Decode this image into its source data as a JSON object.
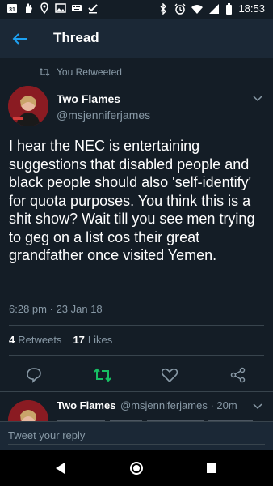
{
  "status_bar": {
    "time": "18:53",
    "left_icons": [
      "calendar-icon",
      "hand-icon",
      "location-icon",
      "image-icon",
      "keyboard-icon",
      "check-icon"
    ],
    "calendar_day": "31",
    "right_icons": [
      "bluetooth-icon",
      "alarm-icon",
      "wifi-icon",
      "signal-icon",
      "battery-icon"
    ]
  },
  "header": {
    "title": "Thread",
    "back_icon": "back-arrow-icon"
  },
  "tweet": {
    "retweet_label": "You Retweeted",
    "author_name": "Two Flames",
    "author_handle": "@msjenniferjames",
    "text": "I hear the NEC is entertaining suggestions that disabled people and black people should also 'self-identify' for quota purposes. You think this is a shit show? Wait till you see men trying to geg on a list cos their great grandfather once visited Yemen.",
    "time": "6:28 pm",
    "date": "23 Jan 18",
    "retweet_count": "4",
    "retweet_label_stat": "Retweets",
    "like_count": "17",
    "like_label_stat": "Likes"
  },
  "actions": {
    "reply_icon": "reply-icon",
    "retweet_icon": "retweet-icon",
    "like_icon": "heart-icon",
    "share_icon": "share-icon",
    "retweet_active_color": "#17bf63"
  },
  "reply": {
    "author_name": "Two Flames",
    "handle_time": "@msjenniferjames · 20m"
  },
  "compose": {
    "placeholder": "Tweet your reply"
  },
  "nav": {
    "back_icon": "nav-back-icon",
    "home_icon": "nav-home-icon",
    "recents_icon": "nav-recents-icon"
  },
  "colors": {
    "background": "#141d26",
    "bar": "#1b2836",
    "accent": "#1da1f2",
    "muted": "#8899a6"
  }
}
